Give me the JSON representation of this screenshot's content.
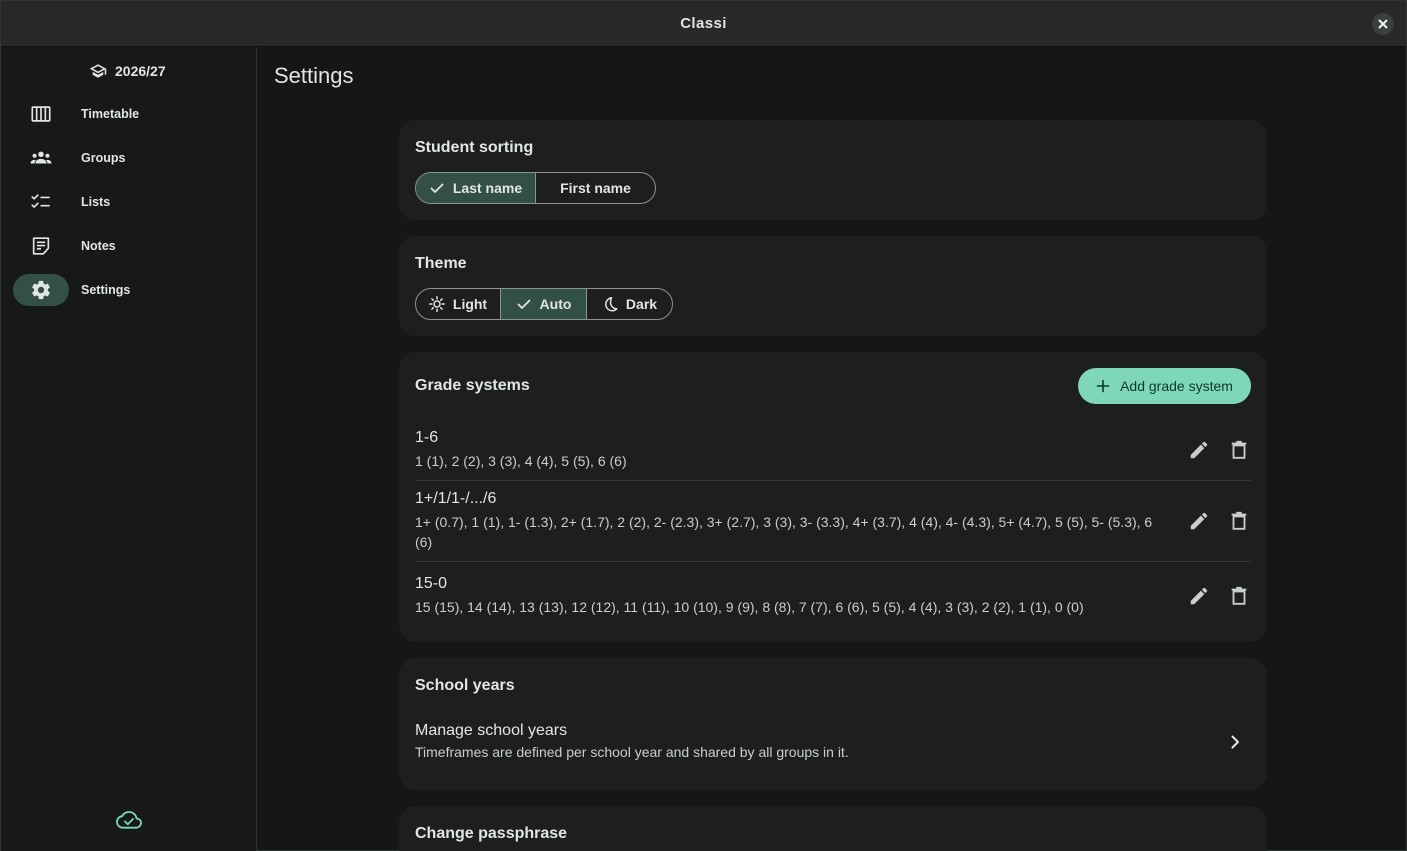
{
  "window": {
    "title": "Classi"
  },
  "sidebar": {
    "year": "2026/27",
    "items": [
      {
        "label": "Timetable",
        "icon": "timetable-icon",
        "active": false
      },
      {
        "label": "Groups",
        "icon": "groups-icon",
        "active": false
      },
      {
        "label": "Lists",
        "icon": "lists-icon",
        "active": false
      },
      {
        "label": "Notes",
        "icon": "notes-icon",
        "active": false
      },
      {
        "label": "Settings",
        "icon": "gear-icon",
        "active": true
      }
    ],
    "sync_icon": "cloud-done-icon"
  },
  "page": {
    "title": "Settings"
  },
  "student_sorting": {
    "title": "Student sorting",
    "options": [
      "Last name",
      "First name"
    ],
    "selected": "Last name"
  },
  "theme": {
    "title": "Theme",
    "options": [
      "Light",
      "Auto",
      "Dark"
    ],
    "selected": "Auto"
  },
  "grade_systems": {
    "title": "Grade systems",
    "add_label": "Add grade system",
    "items": [
      {
        "name": "1-6",
        "grades": "1 (1), 2 (2), 3 (3), 4 (4), 5 (5), 6 (6)"
      },
      {
        "name": "1+/1/1-/.../6",
        "grades": "1+ (0.7), 1 (1), 1- (1.3), 2+ (1.7), 2 (2), 2- (2.3), 3+ (2.7), 3 (3), 3- (3.3), 4+ (3.7), 4 (4), 4- (4.3), 5+ (4.7), 5 (5), 5- (5.3), 6 (6)"
      },
      {
        "name": "15-0",
        "grades": "15 (15), 14 (14), 13 (13), 12 (12), 11 (11), 10 (10), 9 (9), 8 (8), 7 (7), 6 (6), 5 (5), 4 (4), 3 (3), 2 (2), 1 (1), 0 (0)"
      }
    ]
  },
  "school_years": {
    "title": "School years",
    "manage_title": "Manage school years",
    "manage_desc": "Timeframes are defined per school year and shared by all groups in it."
  },
  "passphrase": {
    "title": "Change passphrase"
  },
  "colors": {
    "accent": "#7ed7b9",
    "selected_bg": "#335046",
    "card_bg": "#1c1f1e"
  }
}
